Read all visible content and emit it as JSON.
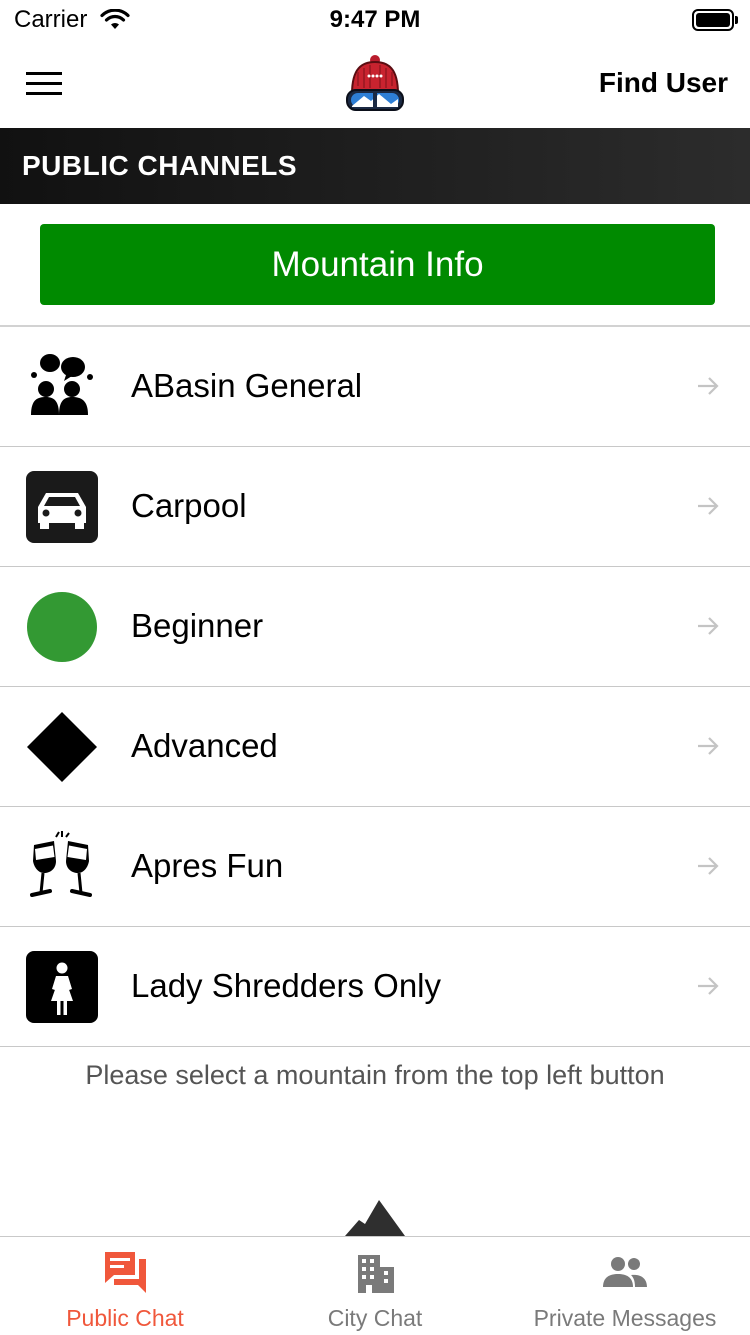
{
  "status_bar": {
    "carrier": "Carrier",
    "time": "9:47 PM"
  },
  "nav": {
    "find_user_label": "Find User"
  },
  "section_header": {
    "title": "PUBLIC CHANNELS"
  },
  "mountain_info_button": {
    "label": "Mountain Info",
    "color": "#008a00"
  },
  "channels": [
    {
      "label": "ABasin General",
      "icon": "group-chat-icon"
    },
    {
      "label": "Carpool",
      "icon": "car-icon"
    },
    {
      "label": "Beginner",
      "icon": "green-circle-icon"
    },
    {
      "label": "Advanced",
      "icon": "black-diamond-icon"
    },
    {
      "label": "Apres Fun",
      "icon": "wine-glasses-icon"
    },
    {
      "label": "Lady Shredders Only",
      "icon": "woman-icon"
    }
  ],
  "hint": {
    "text": "Please select a mountain from the top left button"
  },
  "tab_bar": {
    "active_color": "#f0573b",
    "tabs": [
      {
        "label": "Public Chat",
        "icon": "chat-bubbles-icon",
        "active": true
      },
      {
        "label": "City Chat",
        "icon": "city-building-icon",
        "active": false
      },
      {
        "label": "Private Messages",
        "icon": "people-icon",
        "active": false
      }
    ]
  }
}
